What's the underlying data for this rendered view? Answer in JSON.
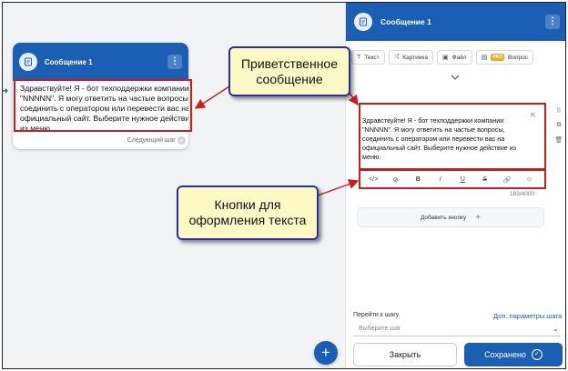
{
  "canvas": {
    "node": {
      "title": "Сообщение 1",
      "text": "Здравствуйте! Я - бот техподдержки компании \"NNNNN\". Я могу ответить на частые вопросы, соединить с оператором или перевести вас на официальный сайт. Выберите нужное действие из меню.",
      "next_step": "Следующий шаг"
    },
    "fab_label": "+"
  },
  "panel": {
    "title": "Сообщение 1",
    "content_types": [
      {
        "label": "Текст",
        "icon": "T"
      },
      {
        "label": "Картинка",
        "icon": "⤨"
      },
      {
        "label": "Файл",
        "icon": "▣"
      },
      {
        "label": "Вопрос",
        "badge": "PRO",
        "icon": "▤"
      }
    ],
    "message_text": "Здравствуйте! Я - бот техподдержки компании \"NNNNN\". Я могу ответить на частые вопросы, соединить с оператором или перевести вас на официальный сайт. Выберите нужное действие из меню.",
    "formatting_tools": [
      {
        "name": "code",
        "glyph": "</>"
      },
      {
        "name": "clear-format",
        "glyph": "⊘"
      },
      {
        "name": "bold",
        "glyph": "B"
      },
      {
        "name": "italic",
        "glyph": "I"
      },
      {
        "name": "underline",
        "glyph": "U"
      },
      {
        "name": "strikethrough",
        "glyph": "S"
      },
      {
        "name": "link",
        "glyph": "🔗"
      },
      {
        "name": "emoji",
        "glyph": "☺"
      }
    ],
    "char_counter": "183/4000",
    "add_button_label": "Добавить кнопку",
    "goto_label": "Перейти к шагу",
    "goto_link": "Доп. параметры шага",
    "goto_placeholder": "Выберите шаг",
    "close_label": "Закрыть",
    "save_label": "Сохранено"
  },
  "annotations": {
    "greeting_callout": "Приветственное сообщение",
    "buttons_callout": "Кнопки для оформления текста",
    "highlight_color": "#cc1c1c",
    "callout_fill": "#fdf9c4"
  },
  "colors": {
    "accent": "#1a5fb4"
  }
}
